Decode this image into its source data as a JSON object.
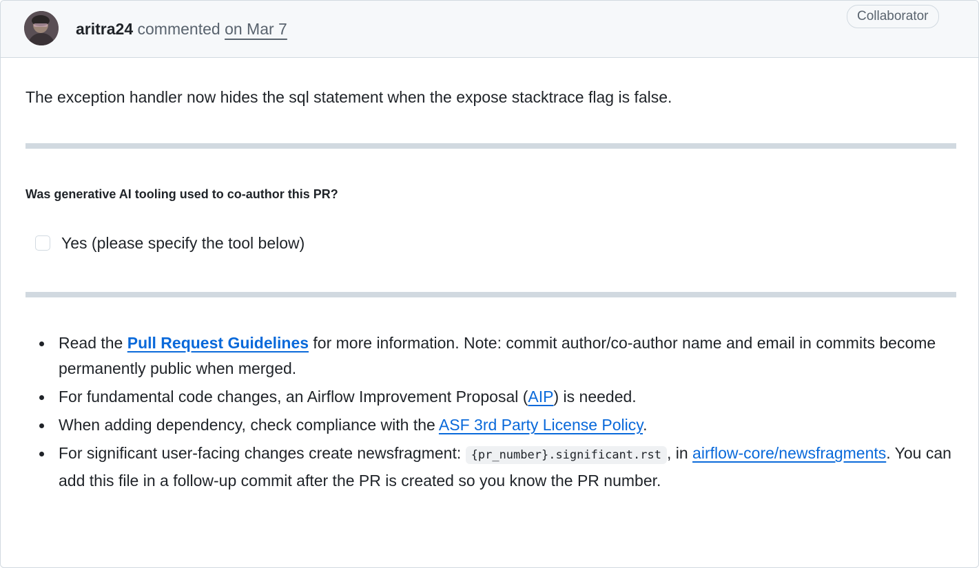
{
  "header": {
    "author": "aritra24",
    "action": "commented",
    "date": "on Mar 7",
    "badge": "Collaborator"
  },
  "body": {
    "text": "The exception handler now hides the sql statement when the expose stacktrace flag is false.",
    "question": "Was generative AI tooling used to co-author this PR?",
    "task": {
      "label": "Yes (please specify the tool below)",
      "checked": false
    }
  },
  "bullets": {
    "b1_prefix": "Read the ",
    "b1_link": "Pull Request Guidelines",
    "b1_suffix": " for more information. Note: commit author/co-author name and email in commits become permanently public when merged.",
    "b2_prefix": "For fundamental code changes, an Airflow Improvement Proposal (",
    "b2_link": "AIP",
    "b2_suffix": ") is needed.",
    "b3_prefix": "When adding dependency, check compliance with the ",
    "b3_link": "ASF 3rd Party License Policy",
    "b3_suffix": ".",
    "b4_prefix": "For significant user-facing changes create newsfragment: ",
    "b4_code": "{pr_number}.significant.rst",
    "b4_mid": ", in ",
    "b4_link": "airflow-core/newsfragments",
    "b4_suffix": ". You can add this file in a follow-up commit after the PR is created so you know the PR number."
  },
  "colors": {
    "link": "#0969da",
    "border": "#d1d9e0",
    "header_bg": "#f6f8fa",
    "muted_text": "#59636e"
  }
}
